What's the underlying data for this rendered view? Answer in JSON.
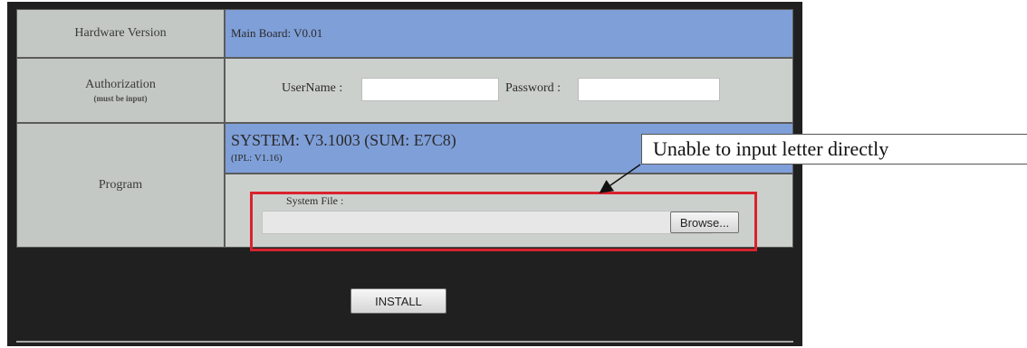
{
  "hardware": {
    "label": "Hardware Version",
    "value": "Main Board: V0.01"
  },
  "authorization": {
    "label": "Authorization",
    "sublabel": "(must be input)",
    "username_label": "UserName :",
    "username_value": "",
    "password_label": "Password :",
    "password_value": ""
  },
  "program": {
    "label": "Program",
    "system_version": "SYSTEM: V3.1003 (SUM: E7C8)",
    "ipl_version": "(IPL: V1.16)",
    "system_file_label": "System File :",
    "file_value": "",
    "browse_label": "Browse..."
  },
  "install_label": "INSTALL",
  "annotation": {
    "text": "Unable to input letter directly",
    "highlight_color": "#d9232e"
  }
}
